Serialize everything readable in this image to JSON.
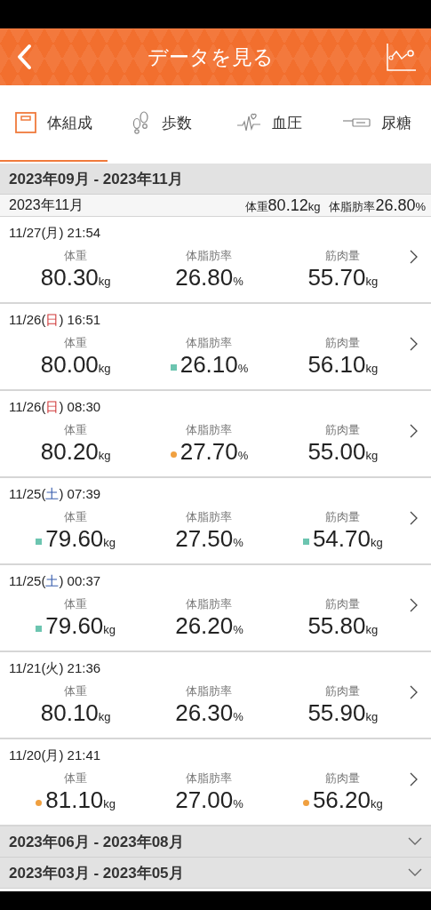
{
  "header": {
    "title": "データを見る"
  },
  "tabs": [
    {
      "label": "体組成",
      "kind": "scale",
      "selected": true
    },
    {
      "label": "歩数",
      "kind": "footprints",
      "selected": false
    },
    {
      "label": "血圧",
      "kind": "heartbeat",
      "selected": false
    },
    {
      "label": "尿糖",
      "kind": "sensor",
      "selected": false
    }
  ],
  "sections": [
    {
      "title": "2023年09月 - 2023年11月",
      "expanded": true,
      "summary": {
        "month": "2023年11月",
        "items": [
          {
            "label": "体重",
            "value": "80.12",
            "unit": "kg"
          },
          {
            "label": "体脂肪率",
            "value": "26.80",
            "unit": "%"
          }
        ]
      },
      "records": [
        {
          "date": "11/27(",
          "weekday": {
            "text": "月",
            "kind": "weekday"
          },
          "time": ") 21:54",
          "values": [
            {
              "label": "体重",
              "value": "80.30",
              "unit": "kg"
            },
            {
              "label": "体脂肪率",
              "value": "26.80",
              "unit": "%"
            },
            {
              "label": "筋肉量",
              "value": "55.70",
              "unit": "kg"
            }
          ]
        },
        {
          "date": "11/26(",
          "weekday": {
            "text": "日",
            "kind": "sunday"
          },
          "time": ") 16:51",
          "values": [
            {
              "label": "体重",
              "value": "80.00",
              "unit": "kg"
            },
            {
              "label": "体脂肪率",
              "value": "26.10",
              "unit": "%",
              "marker": {
                "kind": "square",
                "color": "#6cc5b0"
              }
            },
            {
              "label": "筋肉量",
              "value": "56.10",
              "unit": "kg"
            }
          ]
        },
        {
          "date": "11/26(",
          "weekday": {
            "text": "日",
            "kind": "sunday"
          },
          "time": ") 08:30",
          "values": [
            {
              "label": "体重",
              "value": "80.20",
              "unit": "kg"
            },
            {
              "label": "体脂肪率",
              "value": "27.70",
              "unit": "%",
              "marker": {
                "kind": "circle",
                "color": "#f0a040"
              }
            },
            {
              "label": "筋肉量",
              "value": "55.00",
              "unit": "kg"
            }
          ]
        },
        {
          "date": "11/25(",
          "weekday": {
            "text": "土",
            "kind": "saturday"
          },
          "time": ") 07:39",
          "values": [
            {
              "label": "体重",
              "value": "79.60",
              "unit": "kg",
              "marker": {
                "kind": "square",
                "color": "#6cc5b0"
              }
            },
            {
              "label": "体脂肪率",
              "value": "27.50",
              "unit": "%"
            },
            {
              "label": "筋肉量",
              "value": "54.70",
              "unit": "kg",
              "marker": {
                "kind": "square",
                "color": "#6cc5b0"
              }
            }
          ]
        },
        {
          "date": "11/25(",
          "weekday": {
            "text": "土",
            "kind": "saturday"
          },
          "time": ") 00:37",
          "values": [
            {
              "label": "体重",
              "value": "79.60",
              "unit": "kg",
              "marker": {
                "kind": "square",
                "color": "#6cc5b0"
              }
            },
            {
              "label": "体脂肪率",
              "value": "26.20",
              "unit": "%"
            },
            {
              "label": "筋肉量",
              "value": "55.80",
              "unit": "kg"
            }
          ]
        },
        {
          "date": "11/21(",
          "weekday": {
            "text": "火",
            "kind": "weekday"
          },
          "time": ") 21:36",
          "values": [
            {
              "label": "体重",
              "value": "80.10",
              "unit": "kg"
            },
            {
              "label": "体脂肪率",
              "value": "26.30",
              "unit": "%"
            },
            {
              "label": "筋肉量",
              "value": "55.90",
              "unit": "kg"
            }
          ]
        },
        {
          "date": "11/20(",
          "weekday": {
            "text": "月",
            "kind": "weekday"
          },
          "time": ") 21:41",
          "values": [
            {
              "label": "体重",
              "value": "81.10",
              "unit": "kg",
              "marker": {
                "kind": "circle",
                "color": "#f0a040"
              }
            },
            {
              "label": "体脂肪率",
              "value": "27.00",
              "unit": "%"
            },
            {
              "label": "筋肉量",
              "value": "56.20",
              "unit": "kg",
              "marker": {
                "kind": "circle",
                "color": "#f0a040"
              }
            }
          ]
        }
      ]
    },
    {
      "title": "2023年06月 - 2023年08月",
      "expanded": false
    },
    {
      "title": "2023年03月 - 2023年05月",
      "expanded": false
    }
  ]
}
